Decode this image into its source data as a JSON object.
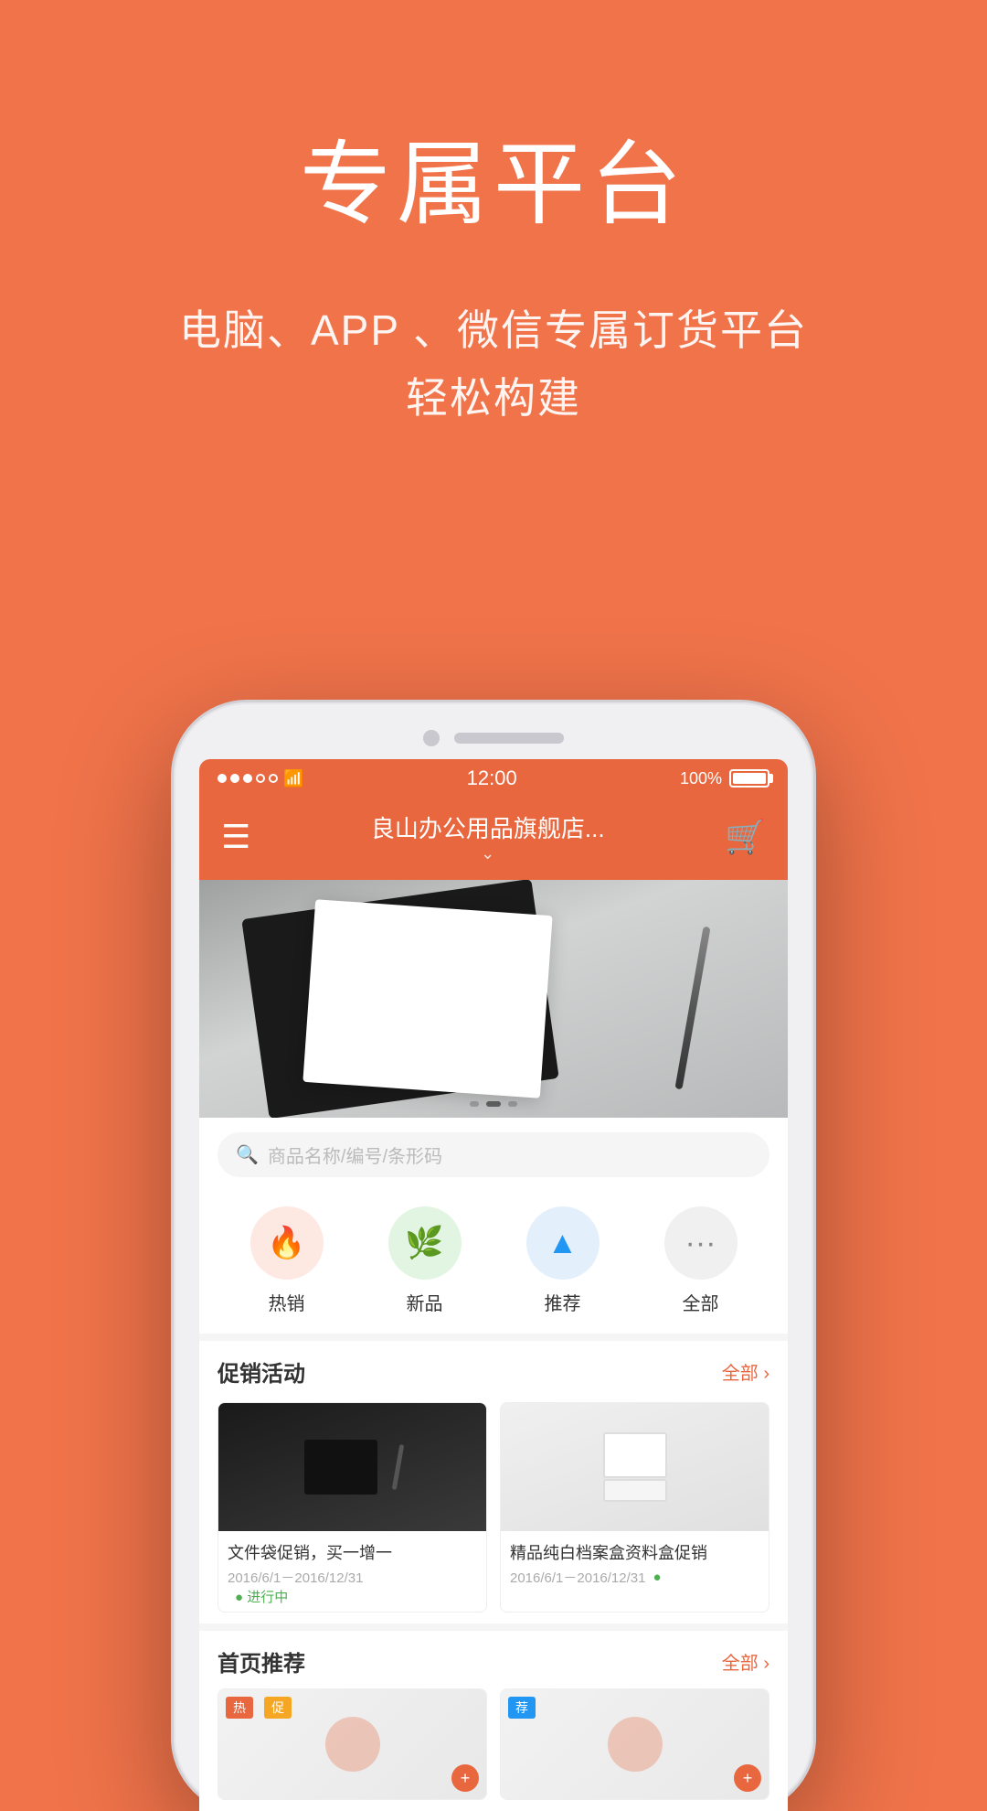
{
  "hero": {
    "title": "专属平台",
    "subtitle_line1": "电脑、APP 、微信专属订货平台",
    "subtitle_line2": "轻松构建"
  },
  "phone": {
    "status": {
      "time": "12:00",
      "battery": "100%",
      "signal_icon": "●●●○○",
      "wifi_icon": "WiFi"
    },
    "nav": {
      "menu_icon": "≡",
      "title": "良山办公用品旗舰店...",
      "cart_icon": "🛒"
    },
    "search": {
      "placeholder": "商品名称/编号/条形码"
    },
    "categories": [
      {
        "id": "hot",
        "label": "热销",
        "icon": "🔥"
      },
      {
        "id": "new",
        "label": "新品",
        "icon": "🌿"
      },
      {
        "id": "rec",
        "label": "推荐",
        "icon": "▲"
      },
      {
        "id": "all",
        "label": "全部",
        "icon": "···"
      }
    ],
    "promo_section": {
      "title": "促销活动",
      "more_label": "全部",
      "items": [
        {
          "name": "文件袋促销，买一增一",
          "date_range": "2016/6/1－2016/12/31",
          "status": "● 进行中"
        },
        {
          "name": "精品纯白档案盒资料盒促销",
          "date_range": "2016/6/1－2016/12/31",
          "status": "●"
        }
      ]
    },
    "recommend_section": {
      "title": "首页推荐",
      "more_label": "全部"
    }
  },
  "colors": {
    "primary": "#E8673F",
    "background": "#F0734A"
  }
}
